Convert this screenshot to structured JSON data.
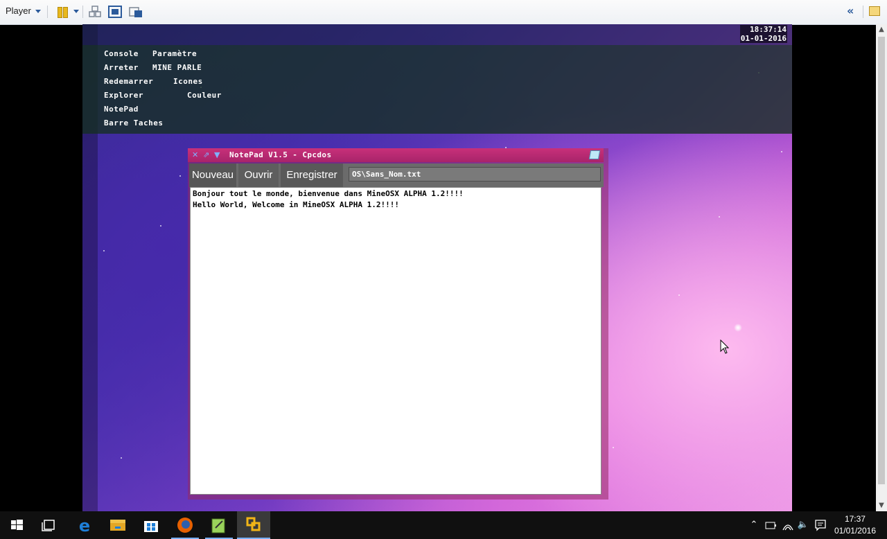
{
  "vmware": {
    "player_menu": "Player",
    "icons": [
      "pause-icon",
      "send-ctrl-alt-del-icon",
      "fullscreen-icon",
      "unity-icon",
      "double-chevron-icon",
      "library-icon"
    ]
  },
  "guest": {
    "clock": {
      "time": "18:37:14",
      "date": "01-01-2016"
    },
    "menu": {
      "console": "Console",
      "parametre": "Paramètre",
      "arreter": "Arreter",
      "mine_parle": "MINE PARLE",
      "redemarrer": "Redemarrer",
      "icones": "Icones",
      "explorer": "Explorer",
      "couleur": "Couleur",
      "notepad": "NotePad",
      "barre_taches": "Barre Taches"
    },
    "notepad": {
      "title": "NotePad V1.5 - Cpcdos",
      "buttons": {
        "new": "Nouveau",
        "open": "Ouvrir",
        "save": "Enregistrer"
      },
      "path": "OS\\Sans_Nom.txt",
      "lines": [
        "Bonjour tout le monde, bienvenue dans MineOSX ALPHA 1.2!!!!",
        "Hello World, Welcome in MineOSX ALPHA 1.2!!!!"
      ]
    }
  },
  "taskbar": {
    "apps": [
      "windows-start-icon",
      "task-view-icon",
      "edge-icon",
      "file-explorer-icon",
      "store-icon",
      "firefox-icon",
      "notepad-plus-icon",
      "vmware-player-icon"
    ],
    "clock": {
      "time": "17:37",
      "date": "01/01/2016"
    }
  }
}
